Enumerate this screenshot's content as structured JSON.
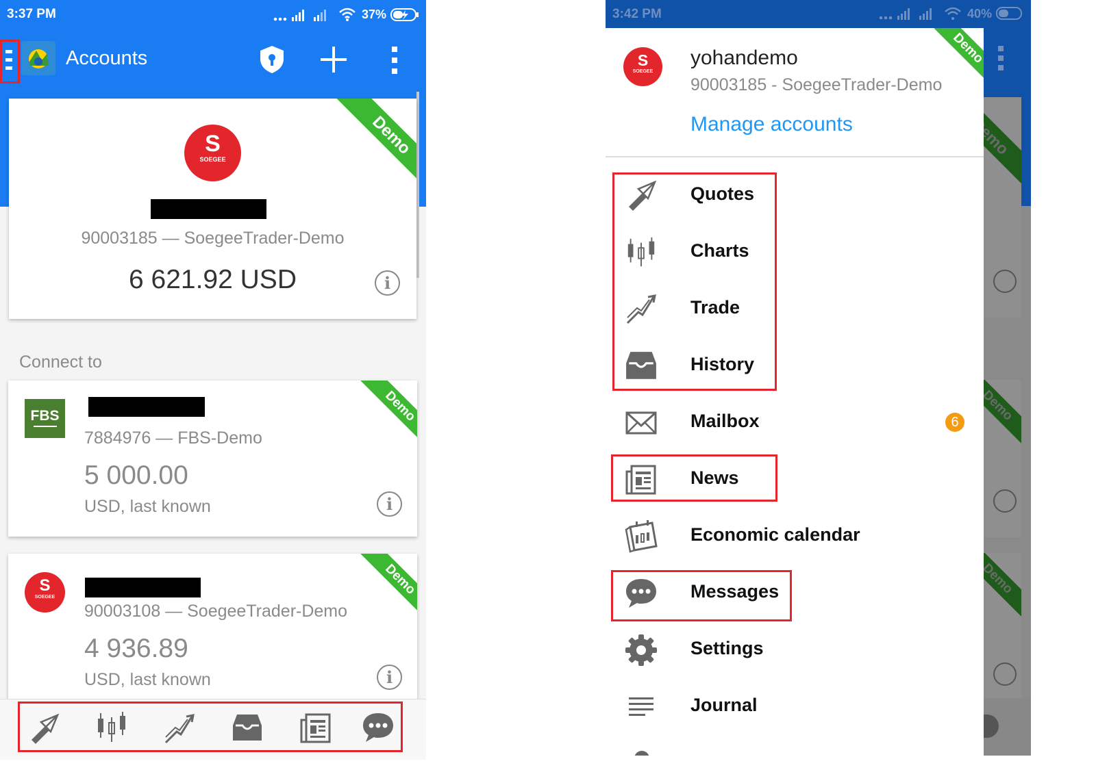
{
  "left": {
    "status": {
      "time": "3:37 PM",
      "battery": "37%"
    },
    "appbar": {
      "title": "Accounts"
    },
    "main_account": {
      "number_server": "90003185 — SoegeeTrader-Demo",
      "balance": "6 621.92 USD",
      "badge": "Demo",
      "logo_text": "SOEGEE"
    },
    "connect_to_label": "Connect to",
    "accounts": [
      {
        "number_server": "7884976 — FBS-Demo",
        "balance": "5 000.00",
        "balance_note": "USD, last known",
        "badge": "Demo",
        "logo_text": "FBS"
      },
      {
        "number_server": "90003108 — SoegeeTrader-Demo",
        "balance": "4 936.89",
        "balance_note": "USD, last known",
        "badge": "Demo",
        "logo_text": "SOEGEE"
      }
    ],
    "bottom_nav": [
      "quotes-icon",
      "charts-icon",
      "trade-icon",
      "history-icon",
      "news-icon",
      "messages-icon"
    ]
  },
  "right": {
    "status": {
      "time": "3:42 PM",
      "battery": "40%"
    },
    "account": {
      "username": "yohandemo",
      "number_server": "90003185 - SoegeeTrader-Demo",
      "manage_label": "Manage accounts",
      "badge": "Demo",
      "logo_text": "SOEGEE"
    },
    "menu": [
      {
        "label": "Quotes",
        "icon": "quotes-icon"
      },
      {
        "label": "Charts",
        "icon": "charts-icon"
      },
      {
        "label": "Trade",
        "icon": "trade-icon"
      },
      {
        "label": "History",
        "icon": "history-icon"
      },
      {
        "label": "Mailbox",
        "icon": "mailbox-icon",
        "badge": "6"
      },
      {
        "label": "News",
        "icon": "news-icon"
      },
      {
        "label": "Economic calendar",
        "icon": "calendar-icon"
      },
      {
        "label": "Messages",
        "icon": "messages-icon"
      },
      {
        "label": "Settings",
        "icon": "gear-icon"
      },
      {
        "label": "Journal",
        "icon": "journal-icon"
      }
    ],
    "background_badges": [
      "Demo",
      "Demo",
      "Demo"
    ]
  },
  "colors": {
    "accent": "#1a7cf2",
    "demo_ribbon": "#3db833",
    "highlight": "#e3262b",
    "brand_red": "#e3262b",
    "link": "#2196f3",
    "mail_badge": "#f39c12"
  }
}
